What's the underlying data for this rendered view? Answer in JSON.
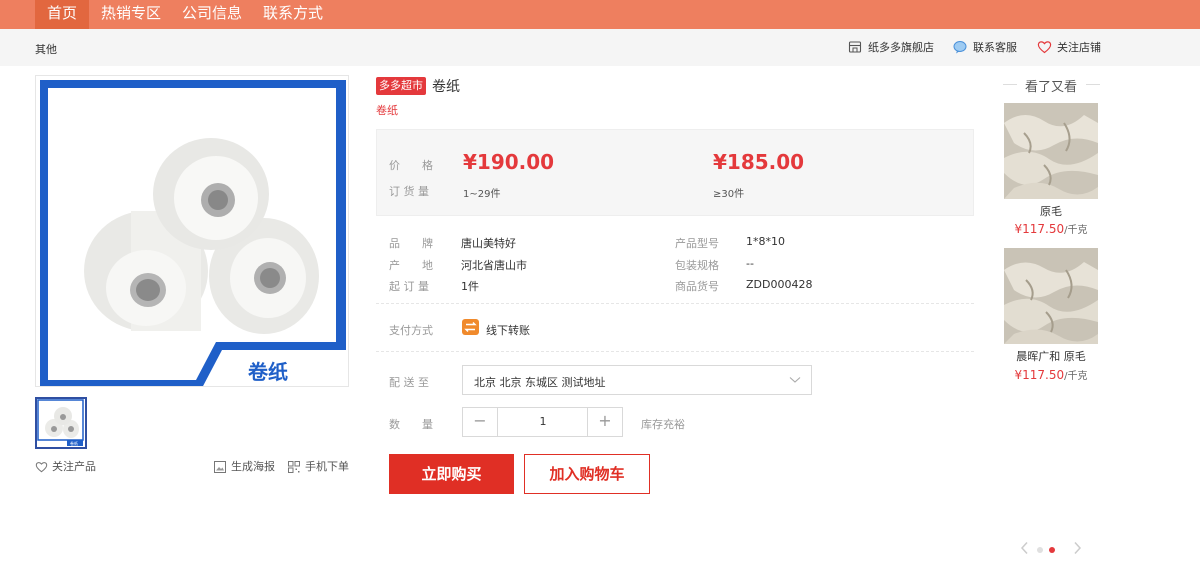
{
  "nav": {
    "items": [
      "首页",
      "热销专区",
      "公司信息",
      "联系方式"
    ],
    "active": "首页"
  },
  "subbar": {
    "breadcrumb": "其他",
    "store": "纸多多旗舰店",
    "service": "联系客服",
    "follow_store": "关注店铺"
  },
  "gallery": {
    "image_caption": "卷纸",
    "thumb_caption": "卷纸",
    "follow_product": "关注产品",
    "poster": "生成海报",
    "mobile_order": "手机下单"
  },
  "product": {
    "badge": "多多超市",
    "title": "卷纸",
    "subtitle": "卷纸",
    "price_label": "价　　格",
    "qty_label": "订 货 量",
    "tiers": [
      {
        "price": "¥190.00",
        "qty": "1~29件"
      },
      {
        "price": "¥185.00",
        "qty": "≥30件"
      }
    ],
    "attrs": [
      {
        "label": "品　　牌",
        "value": "唐山美特好"
      },
      {
        "label": "产　　地",
        "value": "河北省唐山市"
      },
      {
        "label": "起 订 量",
        "value": "1件"
      },
      {
        "label": "产品型号",
        "value": "1*8*10"
      },
      {
        "label": "包装规格",
        "value": "--"
      },
      {
        "label": "商品货号",
        "value": "ZDD000428"
      }
    ],
    "payment_label": "支付方式",
    "payment_value": "线下转账",
    "delivery_label": "配 送 至",
    "delivery_value": "北京 北京 东城区 测试地址",
    "quantity_label": "数　　量",
    "quantity_value": "1",
    "stock_status": "库存充裕",
    "buy_label": "立即购买",
    "cart_label": "加入购物车"
  },
  "recommend": {
    "title": "看了又看",
    "items": [
      {
        "name": "原毛",
        "price": "¥117.50",
        "unit": "/千克"
      },
      {
        "name": "晨晖广和 原毛",
        "price": "¥117.50",
        "unit": "/千克"
      }
    ]
  },
  "colors": {
    "nav_bg": "#ee7f5f",
    "accent_red": "#e4393c",
    "buy_red": "#e02f25",
    "frame_blue": "#1f5fc8"
  }
}
